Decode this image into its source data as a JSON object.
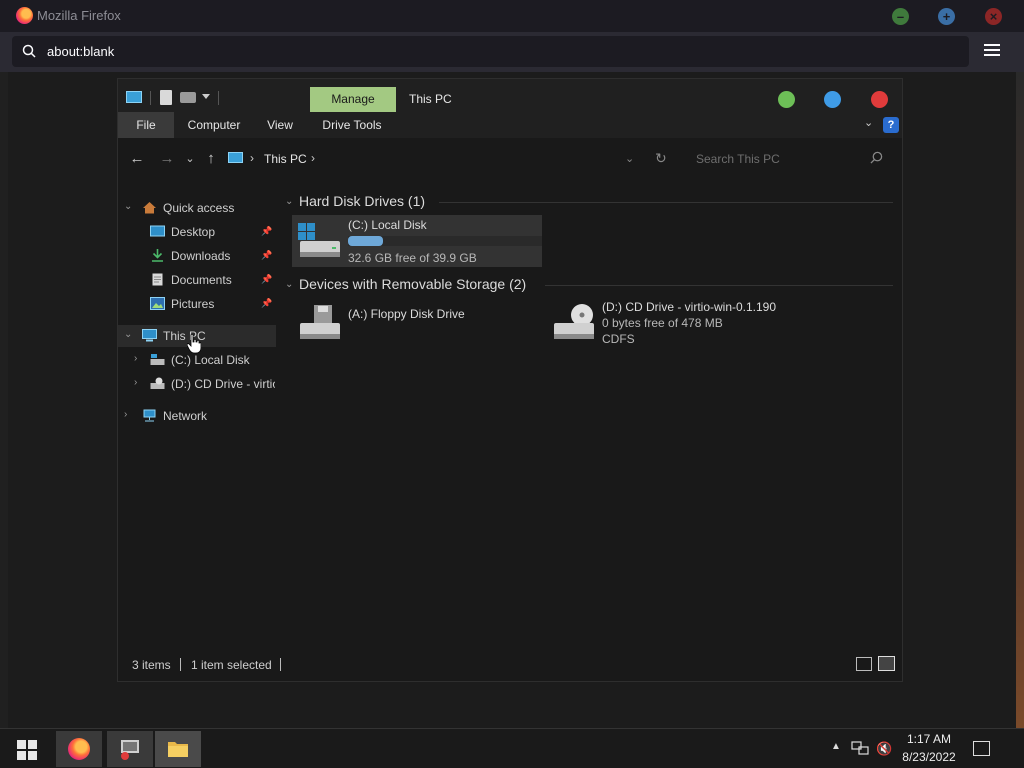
{
  "firefox": {
    "title": "Mozilla Firefox",
    "url": "about:blank"
  },
  "explorer": {
    "ribbon_context_tab": "Manage",
    "title": "This PC",
    "ribbon_tabs": [
      "File",
      "Computer",
      "View",
      "Drive Tools"
    ],
    "breadcrumb": "This PC",
    "search_placeholder": "Search This PC",
    "sidebar": {
      "quick_access": "Quick access",
      "items": [
        "Desktop",
        "Downloads",
        "Documents",
        "Pictures"
      ],
      "this_pc": "This PC",
      "drives": [
        "(C:) Local Disk",
        "(D:) CD Drive - virtio"
      ],
      "network": "Network"
    },
    "groups": [
      {
        "title": "Hard Disk Drives (1)",
        "drives": [
          {
            "name": "(C:) Local Disk",
            "free_text": "32.6 GB free of 39.9 GB",
            "used_fraction": 0.18
          }
        ]
      },
      {
        "title": "Devices with Removable Storage (2)",
        "drives": [
          {
            "name": "(A:) Floppy Disk Drive"
          },
          {
            "name": "(D:) CD Drive - virtio-win-0.1.190",
            "line2": "0 bytes free of 478 MB",
            "line3": "CDFS"
          }
        ]
      }
    ],
    "status": {
      "items": "3 items",
      "selected": "1 item selected"
    }
  },
  "taskbar": {
    "time": "1:17 AM",
    "date": "8/23/2022"
  },
  "colors": {
    "manage_tab": "#a3c982",
    "min_button": "#6dbf57",
    "max_button": "#3f9be6",
    "close_button": "#e03b3b",
    "usage_fill": "#6ea8d8"
  },
  "icons": [
    "search-icon",
    "menu-icon",
    "pc-icon",
    "folder-icon",
    "pin-icon",
    "floppy-drive-icon",
    "cd-drive-icon",
    "hard-drive-icon",
    "network-icon",
    "volume-muted-icon",
    "notification-icon"
  ]
}
